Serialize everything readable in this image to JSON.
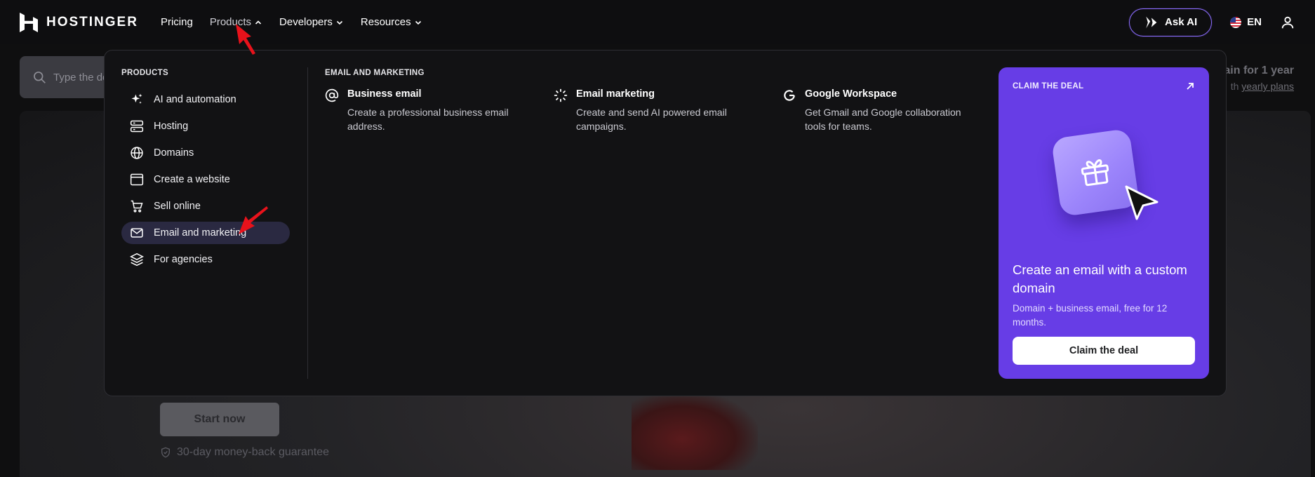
{
  "brand": {
    "name": "HOSTINGER"
  },
  "nav": {
    "items": [
      {
        "label": "Pricing",
        "has_chevron": false,
        "active": false
      },
      {
        "label": "Products",
        "has_chevron": true,
        "active": true
      },
      {
        "label": "Developers",
        "has_chevron": true,
        "active": false
      },
      {
        "label": "Resources",
        "has_chevron": true,
        "active": false
      }
    ],
    "ask_ai_label": "Ask AI",
    "language": "EN"
  },
  "background": {
    "search_placeholder": "Type the de",
    "promo_line1": "ain for 1 year",
    "promo_line2_prefix": "th ",
    "promo_line2_link": "yearly plans",
    "start_button": "Start now",
    "guarantee": "30-day money-back guarantee"
  },
  "menu": {
    "products_title": "PRODUCTS",
    "products": [
      {
        "label": "AI and automation",
        "icon": "sparkle-icon"
      },
      {
        "label": "Hosting",
        "icon": "server-icon"
      },
      {
        "label": "Domains",
        "icon": "globe-icon"
      },
      {
        "label": "Create a website",
        "icon": "browser-window-icon"
      },
      {
        "label": "Sell online",
        "icon": "cart-icon"
      },
      {
        "label": "Email and marketing",
        "icon": "envelope-icon",
        "active": true
      },
      {
        "label": "For agencies",
        "icon": "layers-icon"
      }
    ],
    "section_title": "EMAIL AND MARKETING",
    "offers": [
      {
        "title": "Business email",
        "desc": "Create a professional business email address.",
        "icon": "at-sign-icon"
      },
      {
        "title": "Email marketing",
        "desc": "Create and send AI powered email campaigns.",
        "icon": "spinner-icon"
      },
      {
        "title": "Google Workspace",
        "desc": "Get Gmail and Google collaboration tools for teams.",
        "icon": "google-g-icon"
      }
    ],
    "deal": {
      "label": "CLAIM THE DEAL",
      "heading": "Create an email with a custom domain",
      "sub": "Domain + business email, free for 12 months.",
      "button": "Claim the deal"
    }
  },
  "colors": {
    "accent_purple": "#673de6",
    "active_item_bg": "#2a2941",
    "annotation_red": "#e8121b"
  }
}
